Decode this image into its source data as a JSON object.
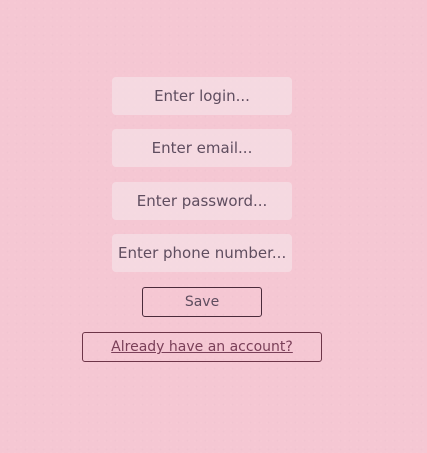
{
  "form": {
    "login_placeholder": "Enter login...",
    "email_placeholder": "Enter email...",
    "password_placeholder": "Enter password...",
    "phone_placeholder": "Enter phone number...",
    "login_value": "",
    "email_value": "",
    "password_value": "",
    "phone_value": "",
    "save_label": "Save",
    "account_link_label": "Already have an account?"
  },
  "colors": {
    "background": "#f5c7d3",
    "field_background": "#f1dde3",
    "text": "#5f4d5f",
    "border": "#4a2a3a",
    "link": "#7a3f58"
  }
}
